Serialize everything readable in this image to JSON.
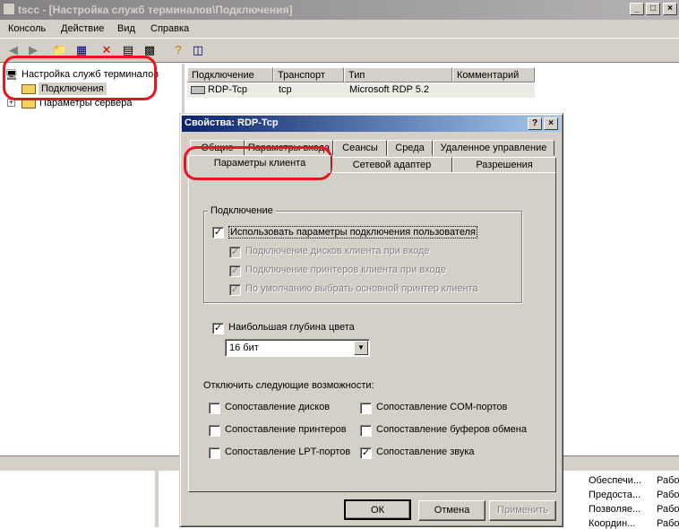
{
  "window": {
    "title": "tscc - [Настройка служб терминалов\\Подключения]",
    "buttons": [
      "_",
      "□",
      "×"
    ]
  },
  "menu": [
    "Консоль",
    "Действие",
    "Вид",
    "Справка"
  ],
  "tree": {
    "root": "Настройка служб терминалов",
    "items": [
      "Подключения",
      "Параметры сервера"
    ]
  },
  "list": {
    "columns": [
      "Подключение",
      "Транспорт",
      "Тип",
      "Комментарий"
    ],
    "rows": [
      {
        "connection": "RDP-Tcp",
        "transport": "tcp",
        "type": "Microsoft RDP 5.2",
        "comment": ""
      }
    ]
  },
  "bottom": {
    "col1": [
      "Обеспечи...",
      "Предоста...",
      "Позволяе...",
      "Координ..."
    ],
    "col2": [
      "Рабо",
      "Рабо",
      "Рабо",
      "Рабо"
    ]
  },
  "dialog": {
    "title": "Свойства: RDP-Tcp",
    "help": "?",
    "close": "×",
    "tabs_back": [
      "Общие",
      "Параметры входа",
      "Сеансы",
      "Среда",
      "Удаленное управление"
    ],
    "tabs_front": [
      "Параметры клиента",
      "Сетевой адаптер",
      "Разрешения"
    ],
    "group_label": "Подключение",
    "use_user_settings": "Использовать параметры подключения пользователя",
    "sub_options": [
      "Подключение дисков клиента при входе",
      "Подключение принтеров клиента при входе",
      "По умолчанию выбрать основной принтер клиента"
    ],
    "max_color_depth": "Наибольшая глубина цвета",
    "color_depth_value": "16 бит",
    "disable_label": "Отключить следующие возможности:",
    "disable_options_left": [
      "Сопоставление дисков",
      "Сопоставление принтеров",
      "Сопоставление LPT-портов"
    ],
    "disable_options_right": [
      "Сопоставление COM-портов",
      "Сопоставление буферов обмена",
      "Сопоставление звука"
    ],
    "buttons": {
      "ok": "ОК",
      "cancel": "Отмена",
      "apply": "Применить"
    }
  },
  "annotation_color": "#e8141e"
}
